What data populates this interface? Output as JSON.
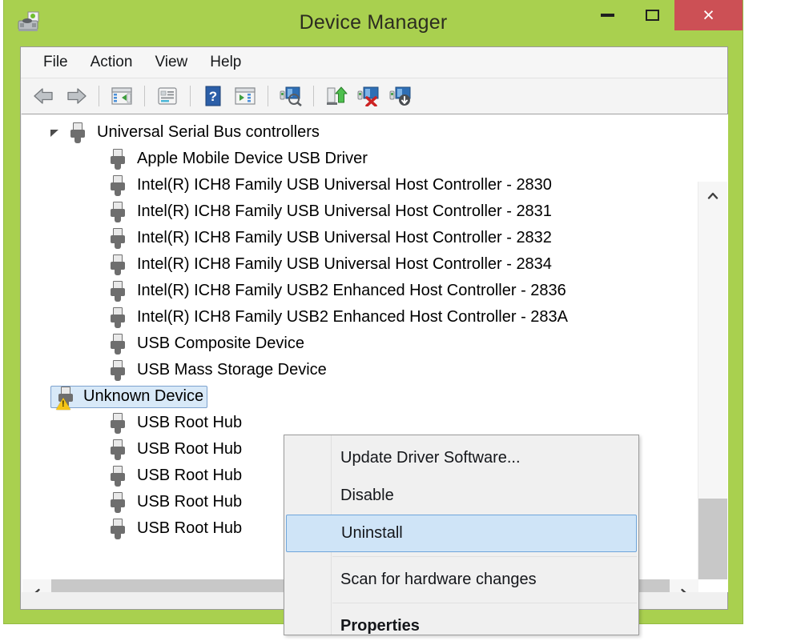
{
  "window": {
    "title": "Device Manager",
    "app_icon": "device-manager-icon",
    "accent_color": "#a9d04f",
    "close_button_color": "#cc5055",
    "caption": {
      "minimize": "minimize-button",
      "maximize": "maximize-button",
      "close": "close-button",
      "close_glyph": "×"
    }
  },
  "menubar": {
    "items": [
      {
        "label": "File",
        "name": "menu-file"
      },
      {
        "label": "Action",
        "name": "menu-action"
      },
      {
        "label": "View",
        "name": "menu-view"
      },
      {
        "label": "Help",
        "name": "menu-help"
      }
    ]
  },
  "toolbar": {
    "buttons": [
      {
        "name": "back-button",
        "icon": "back-arrow-icon"
      },
      {
        "name": "forward-button",
        "icon": "forward-arrow-icon"
      },
      {
        "name": "separator-1",
        "icon": "separator"
      },
      {
        "name": "show-hide-console-tree-button",
        "icon": "console-tree-icon"
      },
      {
        "name": "separator-2",
        "icon": "separator"
      },
      {
        "name": "properties-button",
        "icon": "properties-icon"
      },
      {
        "name": "separator-3",
        "icon": "separator"
      },
      {
        "name": "help-button",
        "icon": "help-question-icon"
      },
      {
        "name": "show-hide-action-pane-button",
        "icon": "action-pane-icon"
      },
      {
        "name": "separator-4",
        "icon": "separator"
      },
      {
        "name": "scan-for-hardware-changes-button",
        "icon": "scan-hardware-icon"
      },
      {
        "name": "separator-5",
        "icon": "separator"
      },
      {
        "name": "update-driver-button",
        "icon": "update-driver-icon"
      },
      {
        "name": "uninstall-device-button",
        "icon": "uninstall-device-icon"
      },
      {
        "name": "add-legacy-hardware-button",
        "icon": "add-hardware-icon"
      }
    ]
  },
  "tree": {
    "root": {
      "label": "Universal Serial Bus controllers",
      "expanded": true,
      "icon": "usb-controller-icon"
    },
    "children": [
      {
        "label": "Apple Mobile Device USB Driver",
        "icon": "usb-device-icon",
        "selected": false,
        "warning": false
      },
      {
        "label": "Intel(R) ICH8 Family USB Universal Host Controller - 2830",
        "icon": "usb-device-icon",
        "selected": false,
        "warning": false
      },
      {
        "label": "Intel(R) ICH8 Family USB Universal Host Controller - 2831",
        "icon": "usb-device-icon",
        "selected": false,
        "warning": false
      },
      {
        "label": "Intel(R) ICH8 Family USB Universal Host Controller - 2832",
        "icon": "usb-device-icon",
        "selected": false,
        "warning": false
      },
      {
        "label": "Intel(R) ICH8 Family USB Universal Host Controller - 2834",
        "icon": "usb-device-icon",
        "selected": false,
        "warning": false
      },
      {
        "label": "Intel(R) ICH8 Family USB2 Enhanced Host Controller - 2836",
        "icon": "usb-device-icon",
        "selected": false,
        "warning": false
      },
      {
        "label": "Intel(R) ICH8 Family USB2 Enhanced Host Controller - 283A",
        "icon": "usb-device-icon",
        "selected": false,
        "warning": false
      },
      {
        "label": "USB Composite Device",
        "icon": "usb-device-icon",
        "selected": false,
        "warning": false
      },
      {
        "label": "USB Mass Storage Device",
        "icon": "usb-device-icon",
        "selected": false,
        "warning": false
      },
      {
        "label": "Unknown Device",
        "icon": "usb-device-icon",
        "selected": true,
        "warning": true
      },
      {
        "label": "USB Root Hub",
        "icon": "usb-device-icon",
        "selected": false,
        "warning": false
      },
      {
        "label": "USB Root Hub",
        "icon": "usb-device-icon",
        "selected": false,
        "warning": false
      },
      {
        "label": "USB Root Hub",
        "icon": "usb-device-icon",
        "selected": false,
        "warning": false
      },
      {
        "label": "USB Root Hub",
        "icon": "usb-device-icon",
        "selected": false,
        "warning": false
      },
      {
        "label": "USB Root Hub",
        "icon": "usb-device-icon",
        "selected": false,
        "warning": false
      }
    ],
    "selected_label": "Unknown Device",
    "selection_bg": "#d8e9f8",
    "selection_border": "#7da2ce"
  },
  "scrollbars": {
    "vertical": {
      "up_glyph": "⌃",
      "down_glyph": "⌄",
      "thumb_color": "#c8c8c8"
    },
    "horizontal": {
      "left_glyph": "‹",
      "right_glyph": "›",
      "thumb_color": "#c8c8c8"
    }
  },
  "context_menu": {
    "highlighted_item": "Uninstall",
    "highlight_bg": "#cfe4f7",
    "highlight_border": "#6fa5da",
    "items": [
      {
        "label": "Update Driver Software...",
        "name": "ctx-update-driver-software",
        "bold": false,
        "highlighted": false,
        "separator_after": false
      },
      {
        "label": "Disable",
        "name": "ctx-disable",
        "bold": false,
        "highlighted": false,
        "separator_after": false
      },
      {
        "label": "Uninstall",
        "name": "ctx-uninstall",
        "bold": false,
        "highlighted": true,
        "separator_after": true
      },
      {
        "label": "Scan for hardware changes",
        "name": "ctx-scan-for-hardware-changes",
        "bold": false,
        "highlighted": false,
        "separator_after": true
      },
      {
        "label": "Properties",
        "name": "ctx-properties",
        "bold": true,
        "highlighted": false,
        "separator_after": false
      }
    ]
  }
}
